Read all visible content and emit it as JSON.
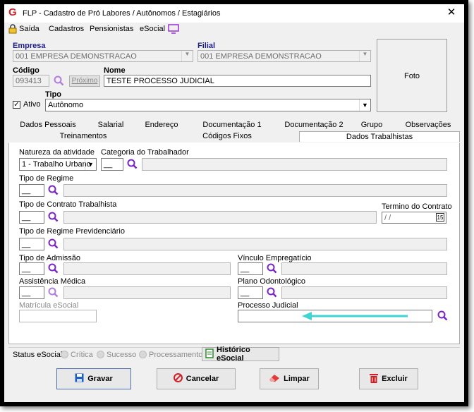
{
  "window": {
    "title": "FLP - Cadastro de Pró Labores / Autônomos / Estagiários",
    "close": "✕"
  },
  "menu": {
    "saida": "Saída",
    "cadastros": "Cadastros",
    "pensionistas": "Pensionistas",
    "esocial": "eSocial"
  },
  "empresa": {
    "label": "Empresa",
    "value": "001 EMPRESA DEMONSTRACAO"
  },
  "filial": {
    "label": "Filial",
    "value": "001 EMPRESA DEMONSTRACAO"
  },
  "codigo": {
    "label": "Código",
    "value": "093413",
    "proximo": "Próximo"
  },
  "nome": {
    "label": "Nome",
    "value": "TESTE PROCESSO JUDICIAL"
  },
  "ativo": {
    "label": "Ativo",
    "checked": true
  },
  "tipo": {
    "label": "Tipo",
    "value": "Autônomo"
  },
  "foto": {
    "label": "Foto"
  },
  "tabs_row1": [
    "Dados Pessoais",
    "Salarial",
    "Endereço",
    "Documentação 1",
    "Documentação 2",
    "Grupo",
    "Observações"
  ],
  "tabs_row2": [
    "Treinamentos",
    "Códigos Fixos",
    "Dados Trabalhistas"
  ],
  "fields": {
    "natureza": {
      "label": "Natureza da atividade",
      "value": "1 - Trabalho Urbano"
    },
    "categoria": {
      "label": "Categoria do Trabalhador",
      "code": "__"
    },
    "tipo_regime": {
      "label": "Tipo de Regime",
      "code": "__"
    },
    "tipo_contrato": {
      "label": "Tipo de Contrato Trabalhista",
      "code": "__"
    },
    "termino": {
      "label": "Termino do Contrato",
      "value": " / /",
      "cal": "15"
    },
    "regime_prev": {
      "label": "Tipo de Regime Previdenciário",
      "code": "__"
    },
    "admissao": {
      "label": "Tipo de Admissão",
      "code": "__"
    },
    "vinculo": {
      "label": "Vínculo Empregatício",
      "code": "__"
    },
    "assistencia": {
      "label": "Assistência Médica",
      "code": "__"
    },
    "plano_odonto": {
      "label": "Plano Odontológico",
      "code": "__"
    },
    "matricula": {
      "label": "Matrícula eSocial"
    },
    "processo": {
      "label": "Processo Judicial"
    }
  },
  "status": {
    "label": "Status eSocial:",
    "critica": "Crítica",
    "sucesso": "Sucesso",
    "processamento": "Processamento",
    "historico": "Histórico eSocial"
  },
  "buttons": {
    "gravar": "Gravar",
    "cancelar": "Cancelar",
    "limpar": "Limpar",
    "excluir": "Excluir"
  },
  "colors": {
    "accent": "#1e1e8c",
    "magnifier": "#8a2be2",
    "arrow": "#3fd4d4",
    "logo": "#d21f26"
  }
}
